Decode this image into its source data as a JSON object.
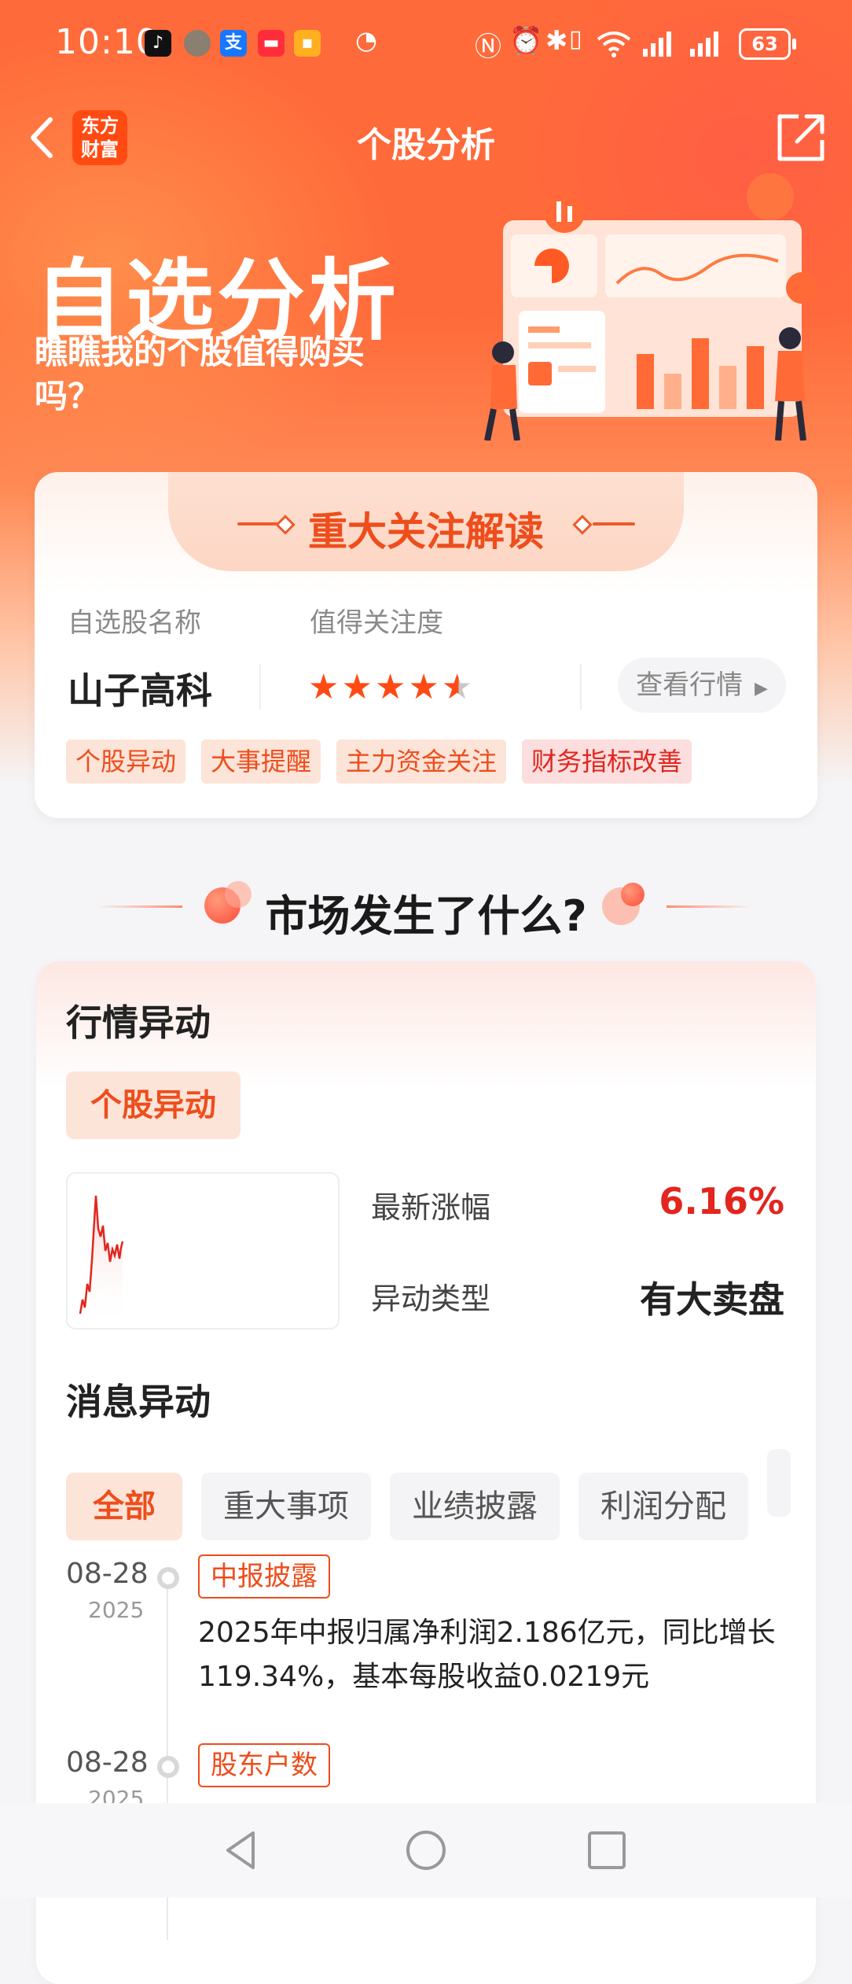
{
  "status_bar": {
    "time": "10:10",
    "battery": "63",
    "apps": [
      "tiktok-icon",
      "avatar-icon",
      "alipay-icon",
      "red-app-icon",
      "yellow-app-icon",
      "speed-icon"
    ],
    "system_icons": [
      "nfc-icon",
      "alarm-icon",
      "bluetooth-icon",
      "vibrate-icon",
      "wifi-icon",
      "signal-icon",
      "signal-icon"
    ]
  },
  "nav": {
    "logo_line1": "东方",
    "logo_line2": "财富",
    "title": "个股分析"
  },
  "hero": {
    "title": "自选分析",
    "subtitle": "瞧瞧我的个股值得购买吗？"
  },
  "focus_card": {
    "banner": "重大关注解读",
    "name_label": "自选股名称",
    "attention_label": "值得关注度",
    "stock_name": "山子高科",
    "rating": 4.5,
    "rating_max": 5,
    "view_button": "查看行情",
    "tags": [
      "个股异动",
      "大事提醒",
      "主力资金关注",
      "财务指标改善"
    ]
  },
  "market_section": {
    "heading": "市场发生了什么?"
  },
  "market_card": {
    "title": "行情异动",
    "type_pill": "个股异动",
    "latest_change_label": "最新涨幅",
    "latest_change_value": "6.16%",
    "anomaly_type_label": "异动类型",
    "anomaly_type_value": "有大卖盘",
    "news_title": "消息异动",
    "filters": [
      "全部",
      "重大事项",
      "业绩披露",
      "利润分配"
    ],
    "timeline": [
      {
        "date": "08-28",
        "year": "2025",
        "tag": "中报披露",
        "text": "2025年中报归属净利润2.186亿元，同比增长119.34%，基本每股收益0.0219元"
      },
      {
        "date": "08-28",
        "year": "2025",
        "tag": "股东户数",
        "text": ""
      }
    ]
  },
  "colors": {
    "brand": "#ff4b12",
    "accent": "#ee4d1c",
    "up_red": "#e2261e"
  }
}
